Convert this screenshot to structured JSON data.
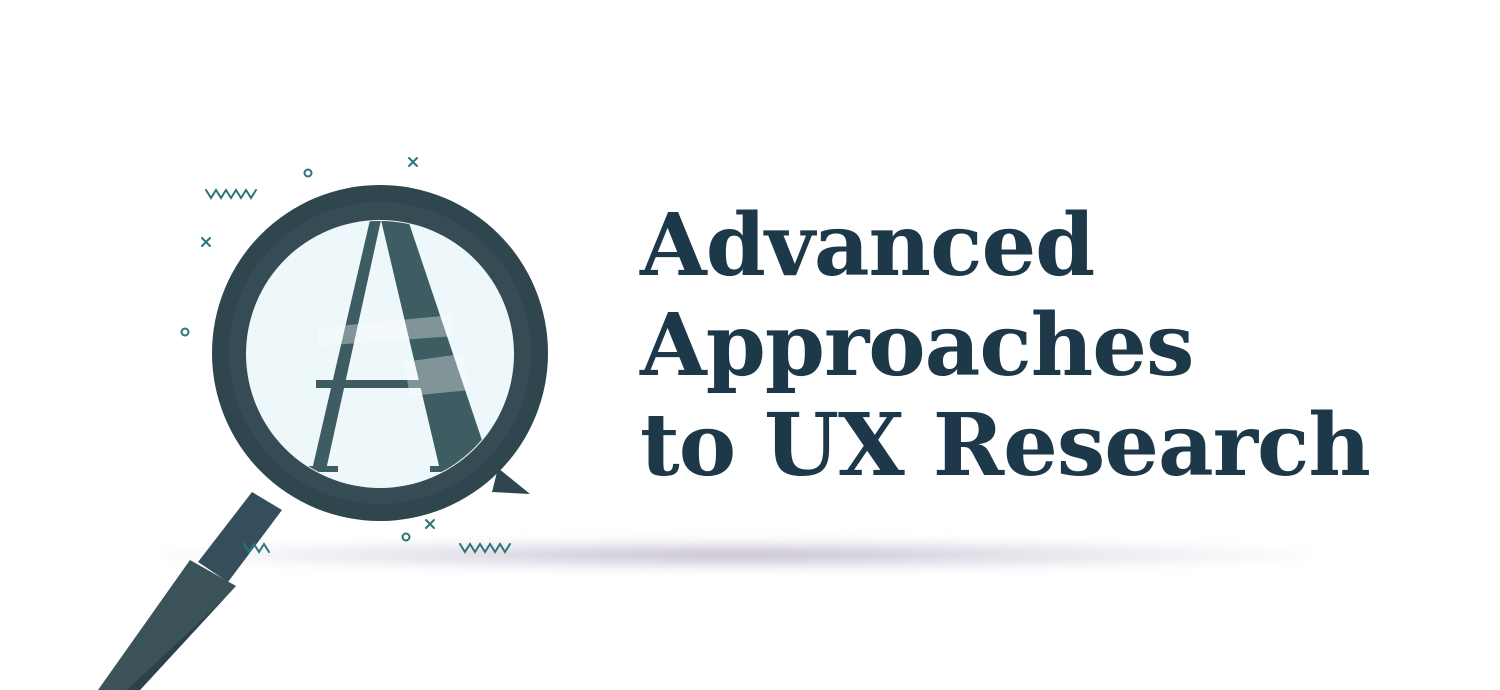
{
  "hero": {
    "title_lines": [
      "Advanced",
      "Approaches",
      "to UX Research"
    ],
    "icons": {
      "magnifier": "magnifying-glass-icon",
      "letter": "A",
      "decorations": [
        "squiggle-icon",
        "circle-icon",
        "cross-icon"
      ]
    },
    "colors": {
      "text": "#1d3849",
      "frame": "#2f4a55",
      "lens": "#eef8fb",
      "accent": "#2d7577"
    }
  }
}
